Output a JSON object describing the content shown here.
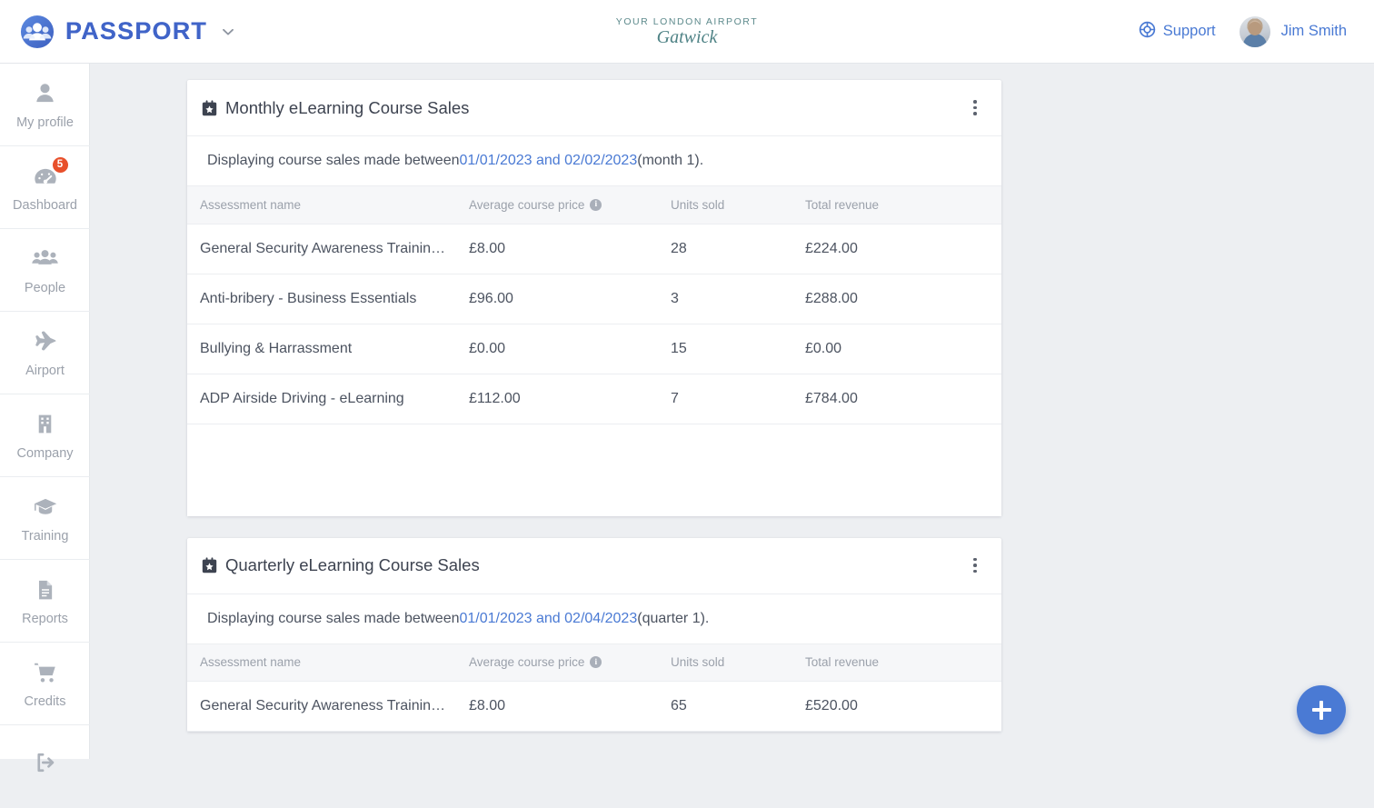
{
  "header": {
    "brand_name": "PASSPORT",
    "brand_icon": "passport-people-logo",
    "brand_caret_icon": "chevron-down-icon",
    "airport_logo": {
      "line1": "YOUR LONDON AIRPORT",
      "line2": "Gatwick"
    },
    "support": {
      "label": "Support",
      "icon": "lifebuoy-icon"
    },
    "user": {
      "name": "Jim Smith",
      "avatar_icon": "user-avatar-photo"
    }
  },
  "sidebar": {
    "items": [
      {
        "label": "My profile",
        "icon": "user-icon",
        "badge": null
      },
      {
        "label": "Dashboard",
        "icon": "speedometer-icon",
        "badge": "5"
      },
      {
        "label": "People",
        "icon": "people-group-icon",
        "badge": null
      },
      {
        "label": "Airport",
        "icon": "airplane-icon",
        "badge": null
      },
      {
        "label": "Company",
        "icon": "building-icon",
        "badge": null
      },
      {
        "label": "Training",
        "icon": "graduation-cap-icon",
        "badge": null
      },
      {
        "label": "Reports",
        "icon": "document-lines-icon",
        "badge": null
      },
      {
        "label": "Credits",
        "icon": "shopping-cart-icon",
        "badge": null
      },
      {
        "label": "",
        "icon": "sign-out-icon",
        "badge": null
      }
    ]
  },
  "cards": [
    {
      "title": "Monthly eLearning Course Sales",
      "title_icon": "calendar-star-icon",
      "menu_icon": "kebab-menu-icon",
      "subtitle_prefix": "Displaying course sales made between ",
      "subtitle_dates": "01/01/2023 and 02/02/2023",
      "subtitle_suffix": " (month 1).",
      "columns": [
        "Assessment name",
        "Average course price",
        "Units sold",
        "Total revenue"
      ],
      "column_info_icon": "info-icon",
      "rows": [
        {
          "name": "General Security Awareness Trainin…",
          "price": "£8.00",
          "units": "28",
          "revenue": "£224.00"
        },
        {
          "name": "Anti-bribery - Business Essentials",
          "price": "£96.00",
          "units": "3",
          "revenue": "£288.00"
        },
        {
          "name": "Bullying & Harrassment",
          "price": "£0.00",
          "units": "15",
          "revenue": "£0.00"
        },
        {
          "name": "ADP Airside Driving - eLearning",
          "price": "£112.00",
          "units": "7",
          "revenue": "£784.00"
        }
      ]
    },
    {
      "title": "Quarterly eLearning Course Sales",
      "title_icon": "calendar-star-icon",
      "menu_icon": "kebab-menu-icon",
      "subtitle_prefix": "Displaying course sales made between ",
      "subtitle_dates": "01/01/2023 and 02/04/2023",
      "subtitle_suffix": " (quarter 1).",
      "columns": [
        "Assessment name",
        "Average course price",
        "Units sold",
        "Total revenue"
      ],
      "column_info_icon": "info-icon",
      "rows": [
        {
          "name": "General Security Awareness Trainin…",
          "price": "£8.00",
          "units": "65",
          "revenue": "£520.00"
        }
      ]
    }
  ],
  "fab": {
    "icon": "plus-icon",
    "label": ""
  },
  "colors": {
    "accent_blue": "#4a7ad4",
    "brand_blue": "#4064c8",
    "badge_red": "#e8502b",
    "page_background": "#edeff2",
    "card_background": "#ffffff",
    "text_primary": "#4c5360",
    "text_muted": "#9ba1ab",
    "gatwick_teal": "#4e8285"
  }
}
